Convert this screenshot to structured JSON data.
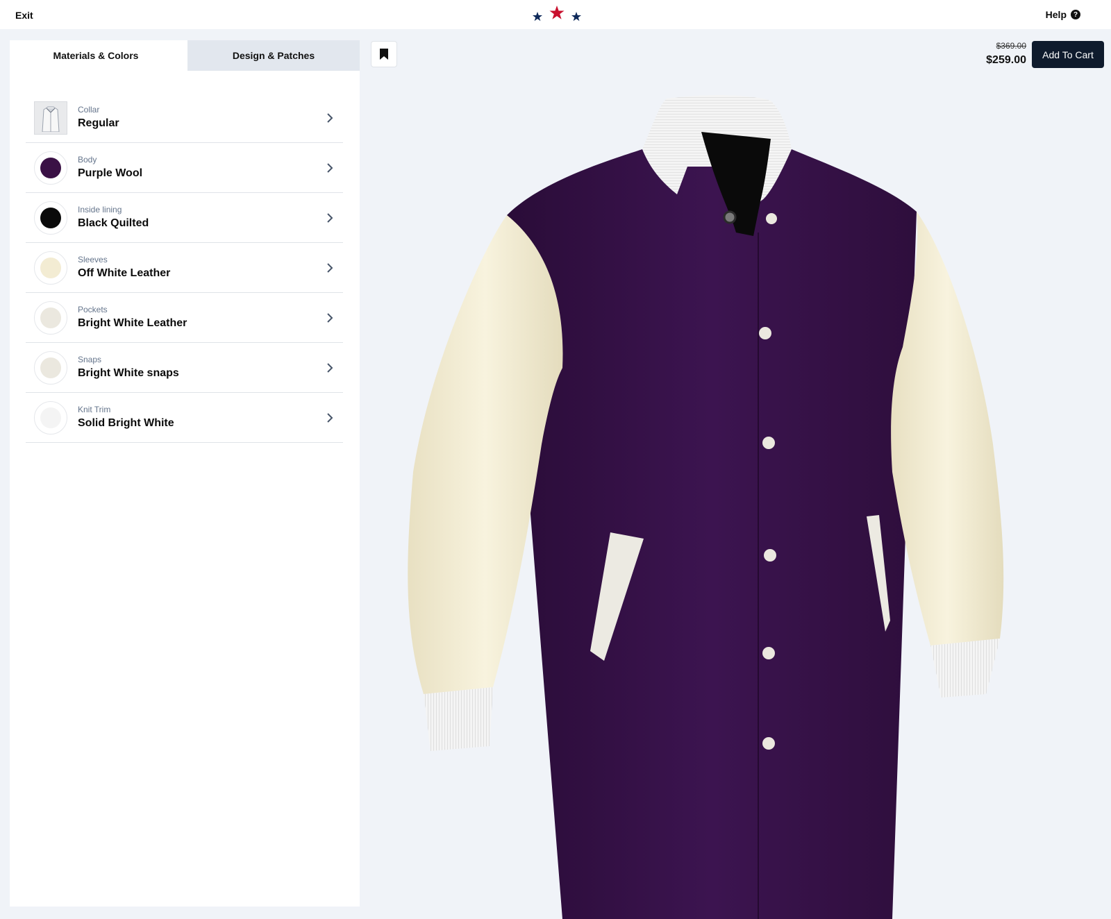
{
  "header": {
    "exit_label": "Exit",
    "logo_icon": "three-stars-logo",
    "help_label": "Help",
    "help_icon_glyph": "?"
  },
  "tabs": [
    {
      "label": "Materials & Colors",
      "active": true
    },
    {
      "label": "Design & Patches",
      "active": false
    }
  ],
  "options": [
    {
      "label": "Collar",
      "value": "Regular",
      "swatch": "collar-thumbnail"
    },
    {
      "label": "Body",
      "value": "Purple Wool",
      "swatch": "#3a1145"
    },
    {
      "label": "Inside lining",
      "value": "Black Quilted",
      "swatch": "#0a0a0a"
    },
    {
      "label": "Sleeves",
      "value": "Off White Leather",
      "swatch": "#f3ecd3"
    },
    {
      "label": "Pockets",
      "value": "Bright White Leather",
      "swatch": "#ebe8df"
    },
    {
      "label": "Snaps",
      "value": "Bright White snaps",
      "swatch": "#ebe8df"
    },
    {
      "label": "Knit Trim",
      "value": "Solid Bright White",
      "swatch": "#f4f4f4"
    }
  ],
  "price": {
    "original": "$369.00",
    "current": "$259.00"
  },
  "cart": {
    "label": "Add To Cart"
  },
  "colors": {
    "body": "#38134a",
    "sleeves": "#f5efd6",
    "trim": "#f2f2f2",
    "accent_dark": "#0f1b2d",
    "logo_red": "#c8102e",
    "logo_blue": "#0f2a5a"
  }
}
